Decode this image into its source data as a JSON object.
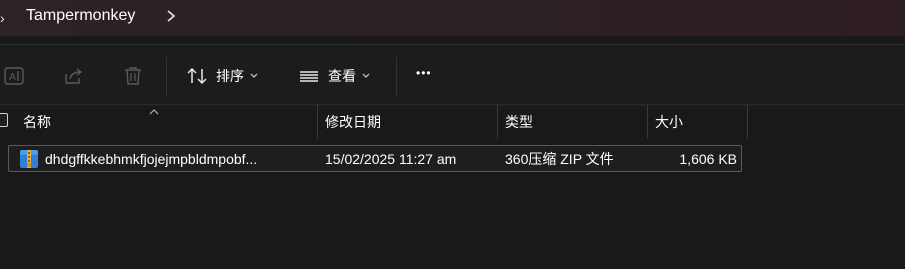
{
  "breadcrumb": {
    "folder": "Tampermonkey"
  },
  "toolbar": {
    "sort_label": "排序",
    "view_label": "查看",
    "more_label": "•••"
  },
  "columns": {
    "name": "名称",
    "modified": "修改日期",
    "type": "类型",
    "size": "大小"
  },
  "files": [
    {
      "name": "dhdgffkkebhmkfjojejmpbldmpobf...",
      "modified": "15/02/2025 11:27 am",
      "type": "360压缩 ZIP 文件",
      "size": "1,606 KB"
    }
  ],
  "colors": {
    "title_bar": "#2b2328",
    "background": "#191919",
    "accent_zip": "#2f7fd6"
  }
}
